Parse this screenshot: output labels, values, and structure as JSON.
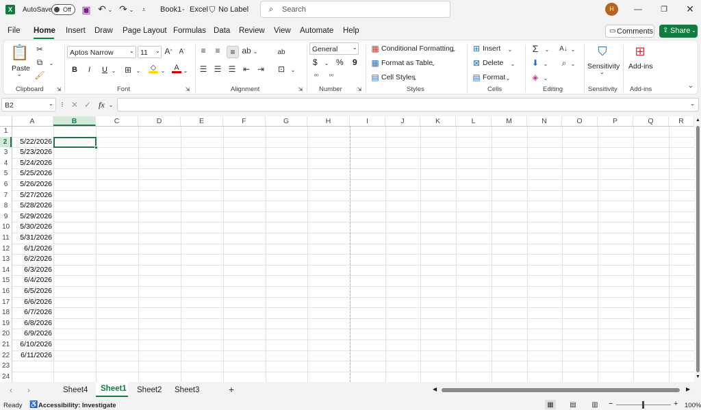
{
  "titlebar": {
    "autosave_label": "AutoSave",
    "autosave_state": "Off",
    "doc_title": "Book1",
    "app_sep": "-",
    "app_name": "Excel",
    "sensitivity_label": "No Label",
    "search_placeholder": "Search",
    "avatar_initial": "H"
  },
  "menu": {
    "tabs": [
      "File",
      "Home",
      "Insert",
      "Draw",
      "Page Layout",
      "Formulas",
      "Data",
      "Review",
      "View",
      "Automate",
      "Help"
    ],
    "active": "Home",
    "comments_label": "Comments",
    "share_label": "Share"
  },
  "ribbon": {
    "clipboard": {
      "paste": "Paste",
      "label": "Clipboard"
    },
    "font": {
      "name": "Aptos Narrow",
      "size": "11",
      "bold": "B",
      "italic": "I",
      "underline": "U",
      "label": "Font"
    },
    "alignment": {
      "label": "Alignment"
    },
    "number": {
      "format": "General",
      "currency": "$",
      "percent": "%",
      "comma": "9",
      "label": "Number"
    },
    "styles": {
      "conditional": "Conditional Formatting",
      "format_table": "Format as Table",
      "cell_styles": "Cell Styles",
      "label": "Styles"
    },
    "cells": {
      "insert": "Insert",
      "delete": "Delete",
      "format": "Format",
      "label": "Cells"
    },
    "editing": {
      "label": "Editing"
    },
    "sensitivity": {
      "button": "Sensitivity",
      "label": "Sensitivity"
    },
    "addins": {
      "button": "Add-ins",
      "label": "Add-ins"
    }
  },
  "formula_bar": {
    "name_box": "B2",
    "fx": "fx",
    "value": ""
  },
  "columns": [
    "A",
    "B",
    "C",
    "D",
    "E",
    "F",
    "G",
    "H",
    "I",
    "J",
    "K",
    "L",
    "M",
    "N",
    "O",
    "P",
    "Q",
    "R"
  ],
  "rows": [
    "1",
    "2",
    "3",
    "4",
    "5",
    "6",
    "7",
    "8",
    "9",
    "10",
    "11",
    "12",
    "13",
    "14",
    "15",
    "16",
    "17",
    "18",
    "19",
    "20",
    "21",
    "22",
    "23",
    "24"
  ],
  "cells_A": [
    "",
    "5/22/2026",
    "5/23/2026",
    "5/24/2026",
    "5/25/2026",
    "5/26/2026",
    "5/27/2026",
    "5/28/2026",
    "5/29/2026",
    "5/30/2026",
    "5/31/2026",
    "6/1/2026",
    "6/2/2026",
    "6/3/2026",
    "6/4/2026",
    "6/5/2026",
    "6/6/2026",
    "6/7/2026",
    "6/8/2026",
    "6/9/2026",
    "6/10/2026",
    "6/11/2026",
    "",
    ""
  ],
  "selected_cell": "B2",
  "sheets": [
    "Sheet4",
    "Sheet1",
    "Sheet2",
    "Sheet3"
  ],
  "active_sheet": "Sheet1",
  "status": {
    "ready": "Ready",
    "accessibility": "Accessibility: Investigate",
    "zoom": "100%"
  },
  "colors": {
    "excel_green": "#107c41",
    "selection": "#217346",
    "share_bg": "#0f7b3f",
    "avatar": "#b5651d"
  }
}
